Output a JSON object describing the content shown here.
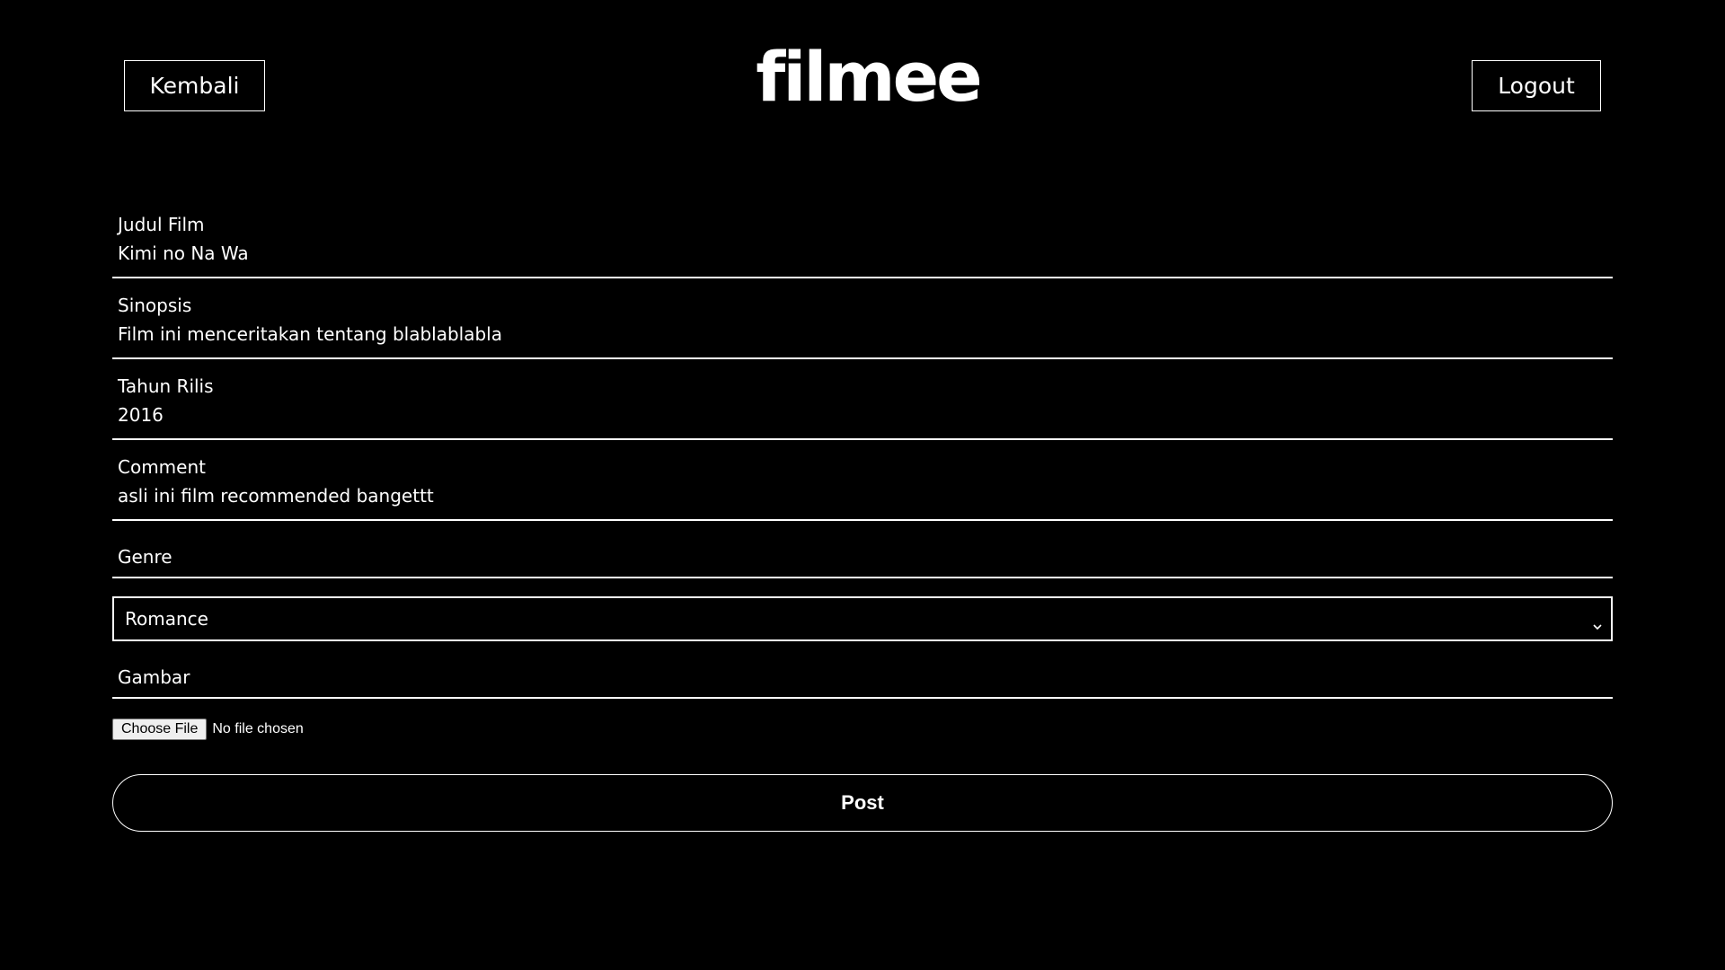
{
  "header": {
    "back_label": "Kembali",
    "logo_text": "filmee",
    "logout_label": "Logout"
  },
  "form": {
    "fields": [
      {
        "label": "Judul Film",
        "value": "Kimi no Na Wa"
      },
      {
        "label": "Sinopsis",
        "value": "Film ini menceritakan tentang blablablabla"
      },
      {
        "label": "Tahun Rilis",
        "value": "2016"
      },
      {
        "label": "Comment",
        "value": "asli ini film recommended bangettt"
      }
    ],
    "genre": {
      "label": "Genre",
      "selected": "Romance"
    },
    "image": {
      "label": "Gambar",
      "button_label": "Choose File",
      "status": "No file chosen"
    },
    "submit_label": "Post"
  },
  "colors": {
    "background": "#000000",
    "foreground": "#ffffff"
  }
}
